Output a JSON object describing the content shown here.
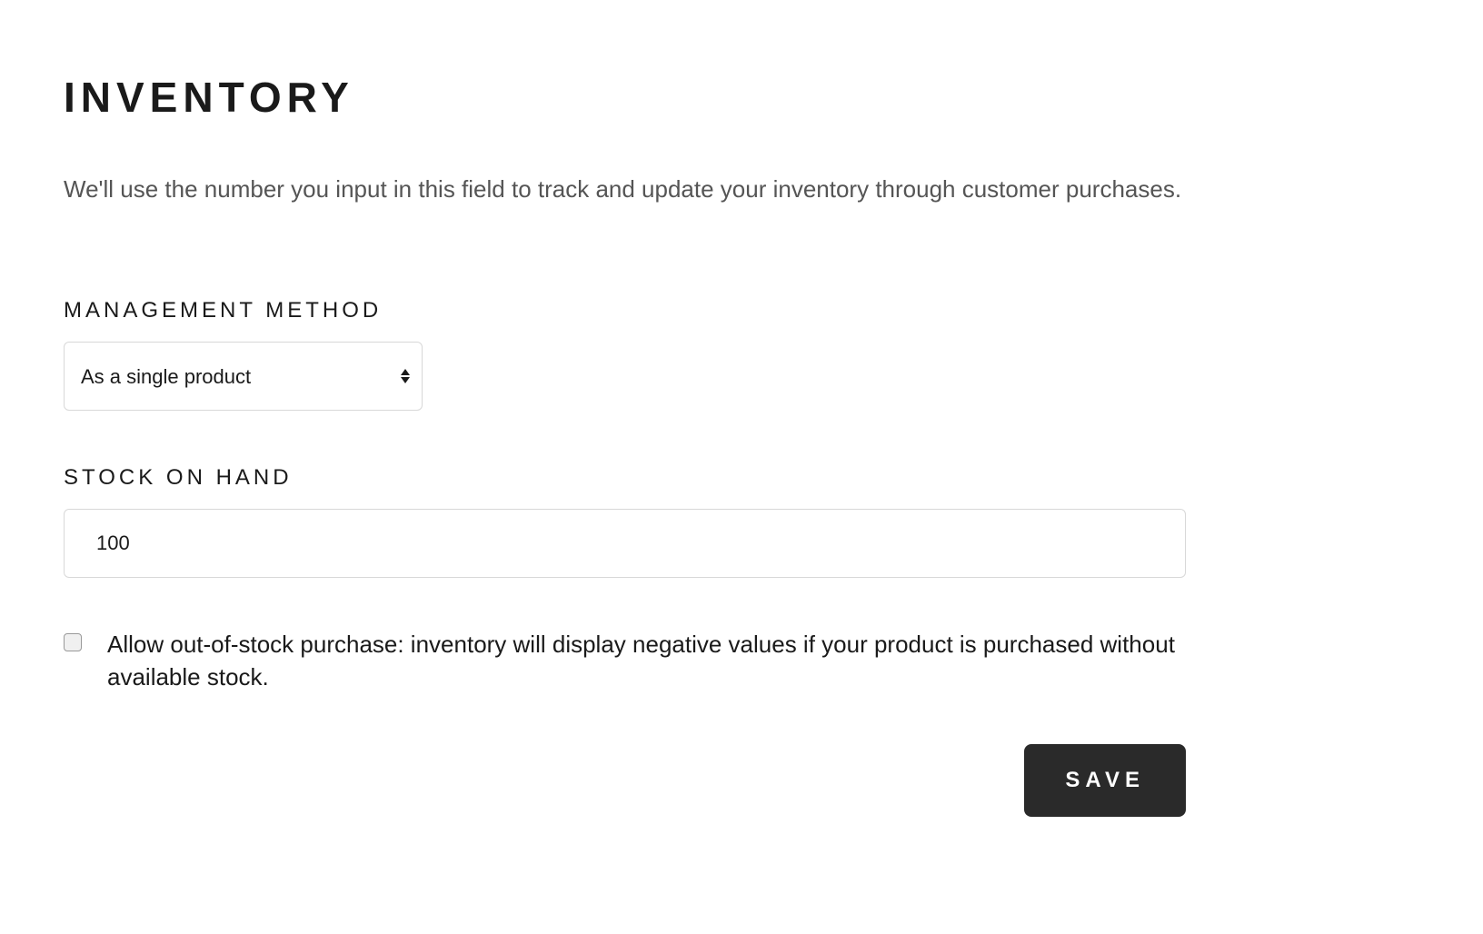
{
  "page": {
    "title": "INVENTORY",
    "description": "We'll use the number you input in this field to track and update your inventory through customer purchases."
  },
  "fields": {
    "management_method": {
      "label": "MANAGEMENT METHOD",
      "selected": "As a single product"
    },
    "stock_on_hand": {
      "label": "STOCK ON HAND",
      "value": "100"
    },
    "allow_out_of_stock": {
      "label": "Allow out-of-stock purchase: inventory will display negative values if your product is purchased without available stock.",
      "checked": false
    }
  },
  "buttons": {
    "save": "SAVE"
  }
}
